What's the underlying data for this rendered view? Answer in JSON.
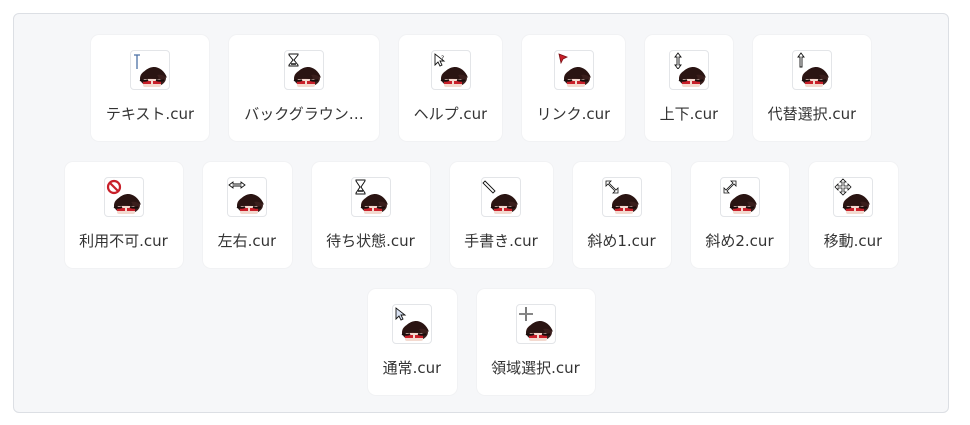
{
  "colors": {
    "panel_bg": "#f6f7f9",
    "card_bg": "#ffffff",
    "hair": "#3a1e1c",
    "accent_red": "#c8202a"
  },
  "items": [
    {
      "label": "テキスト.cur",
      "icon": "text-ibeam-cursor-icon"
    },
    {
      "label": "バックグラウン…",
      "icon": "background-busy-cursor-icon"
    },
    {
      "label": "ヘルプ.cur",
      "icon": "help-cursor-icon"
    },
    {
      "label": "リンク.cur",
      "icon": "link-cursor-icon"
    },
    {
      "label": "上下.cur",
      "icon": "resize-vertical-cursor-icon"
    },
    {
      "label": "代替選択.cur",
      "icon": "alternate-select-cursor-icon"
    },
    {
      "label": "利用不可.cur",
      "icon": "unavailable-cursor-icon"
    },
    {
      "label": "左右.cur",
      "icon": "resize-horizontal-cursor-icon"
    },
    {
      "label": "待ち状態.cur",
      "icon": "busy-hourglass-cursor-icon"
    },
    {
      "label": "手書き.cur",
      "icon": "handwriting-pen-cursor-icon"
    },
    {
      "label": "斜め1.cur",
      "icon": "resize-diagonal-1-cursor-icon"
    },
    {
      "label": "斜め2.cur",
      "icon": "resize-diagonal-2-cursor-icon"
    },
    {
      "label": "移動.cur",
      "icon": "move-cursor-icon"
    },
    {
      "label": "通常.cur",
      "icon": "normal-arrow-cursor-icon"
    },
    {
      "label": "領域選択.cur",
      "icon": "precision-select-cursor-icon"
    }
  ]
}
